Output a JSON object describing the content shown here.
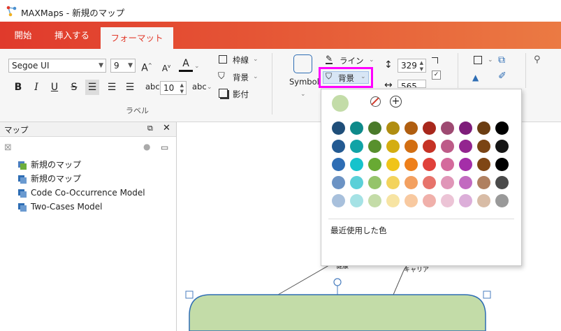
{
  "window": {
    "title": "MAXMaps - 新規のマップ"
  },
  "tabs": [
    {
      "label": "開始"
    },
    {
      "label": "挿入する"
    },
    {
      "label": "フォーマット"
    }
  ],
  "ribbon": {
    "font_family": "Segoe UI",
    "font_size": "9",
    "indent_value": "10",
    "border_label": "枠線",
    "background_label": "背景",
    "shadow_label": "影付",
    "group_label": "ラベル",
    "symbol_label": "Symbol",
    "line_label": "ライン",
    "shape_background_label": "背景",
    "height_value": "329",
    "width_value": "565"
  },
  "map_panel": {
    "title": "マップ",
    "items": [
      {
        "label": "新規のマップ"
      },
      {
        "label": "新規のマップ"
      },
      {
        "label": "Code Co-Occurrence Model"
      },
      {
        "label": "Two-Cases Model"
      }
    ]
  },
  "canvas": {
    "label_health": "健康",
    "label_career": "キャリア"
  },
  "color_popup": {
    "current_color": "#c3dca8",
    "recent_label": "最近使用した色",
    "palette": [
      [
        "#1f4e79",
        "#0e8a8a",
        "#4a7a2a",
        "#b08d10",
        "#b05e10",
        "#a8281c",
        "#9e4a72",
        "#7e1d7a",
        "#6b3d12",
        "#000000"
      ],
      [
        "#235a92",
        "#11a3a6",
        "#58902d",
        "#d4ad10",
        "#d26e12",
        "#c63225",
        "#bd5b88",
        "#93258f",
        "#7a4414",
        "#151515"
      ],
      [
        "#2e6db4",
        "#16c3cc",
        "#68aa33",
        "#f0c419",
        "#ee7f1a",
        "#e0413a",
        "#d46a9c",
        "#a42ea8",
        "#7f4614",
        "#000000"
      ],
      [
        "#6c93c4",
        "#5bd0d8",
        "#95c46a",
        "#f3d35c",
        "#f3a060",
        "#e7736b",
        "#e096b8",
        "#c26ac0",
        "#b08060",
        "#4a4a4a"
      ],
      [
        "#a8c0dc",
        "#a5e2e5",
        "#c4dca8",
        "#f7e4a3",
        "#f8c9a0",
        "#f0b0aa",
        "#ecc4d6",
        "#dcaed9",
        "#d8bca6",
        "#999999"
      ]
    ]
  },
  "colors": {
    "accent": "#e55535",
    "highlight": "#ff00ff"
  }
}
